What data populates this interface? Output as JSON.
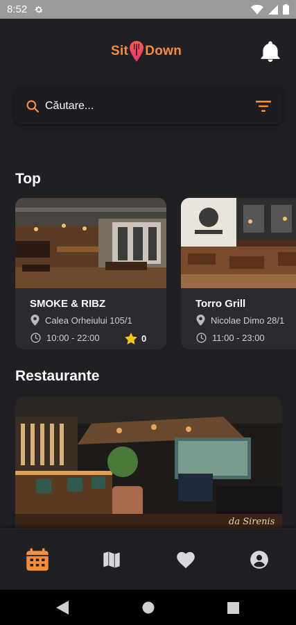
{
  "status_bar": {
    "time": "8:52",
    "icons": [
      "settings-gear-icon",
      "wifi-icon",
      "signal-icon",
      "battery-icon"
    ]
  },
  "header": {
    "logo_left": "Sit",
    "logo_right": "Down",
    "notification_icon": "bell-icon"
  },
  "search": {
    "placeholder": "Căutare...",
    "search_icon": "search-icon",
    "filter_icon": "filter-icon"
  },
  "top": {
    "title": "Top",
    "cards": [
      {
        "name": "SMOKE & RIBZ",
        "address": "Calea Orheiului 105/1",
        "hours": "10:00 - 22:00",
        "rating": "0"
      },
      {
        "name": "Torro Grill",
        "address": "Nicolae Dimo 28/1",
        "hours": "11:00 - 23:00"
      }
    ]
  },
  "restaurants": {
    "title": "Restaurante",
    "featured_signage": "da Sirenis"
  },
  "bottom_nav": {
    "items": [
      "calendar-icon",
      "map-icon",
      "heart-icon",
      "account-icon"
    ],
    "active": "calendar-icon"
  },
  "colors": {
    "accent": "#f58d3b",
    "background": "#1f1f24",
    "card": "#2a2a30",
    "star": "#f5c518"
  },
  "system_nav": [
    "back-icon",
    "home-icon",
    "recents-icon"
  ]
}
